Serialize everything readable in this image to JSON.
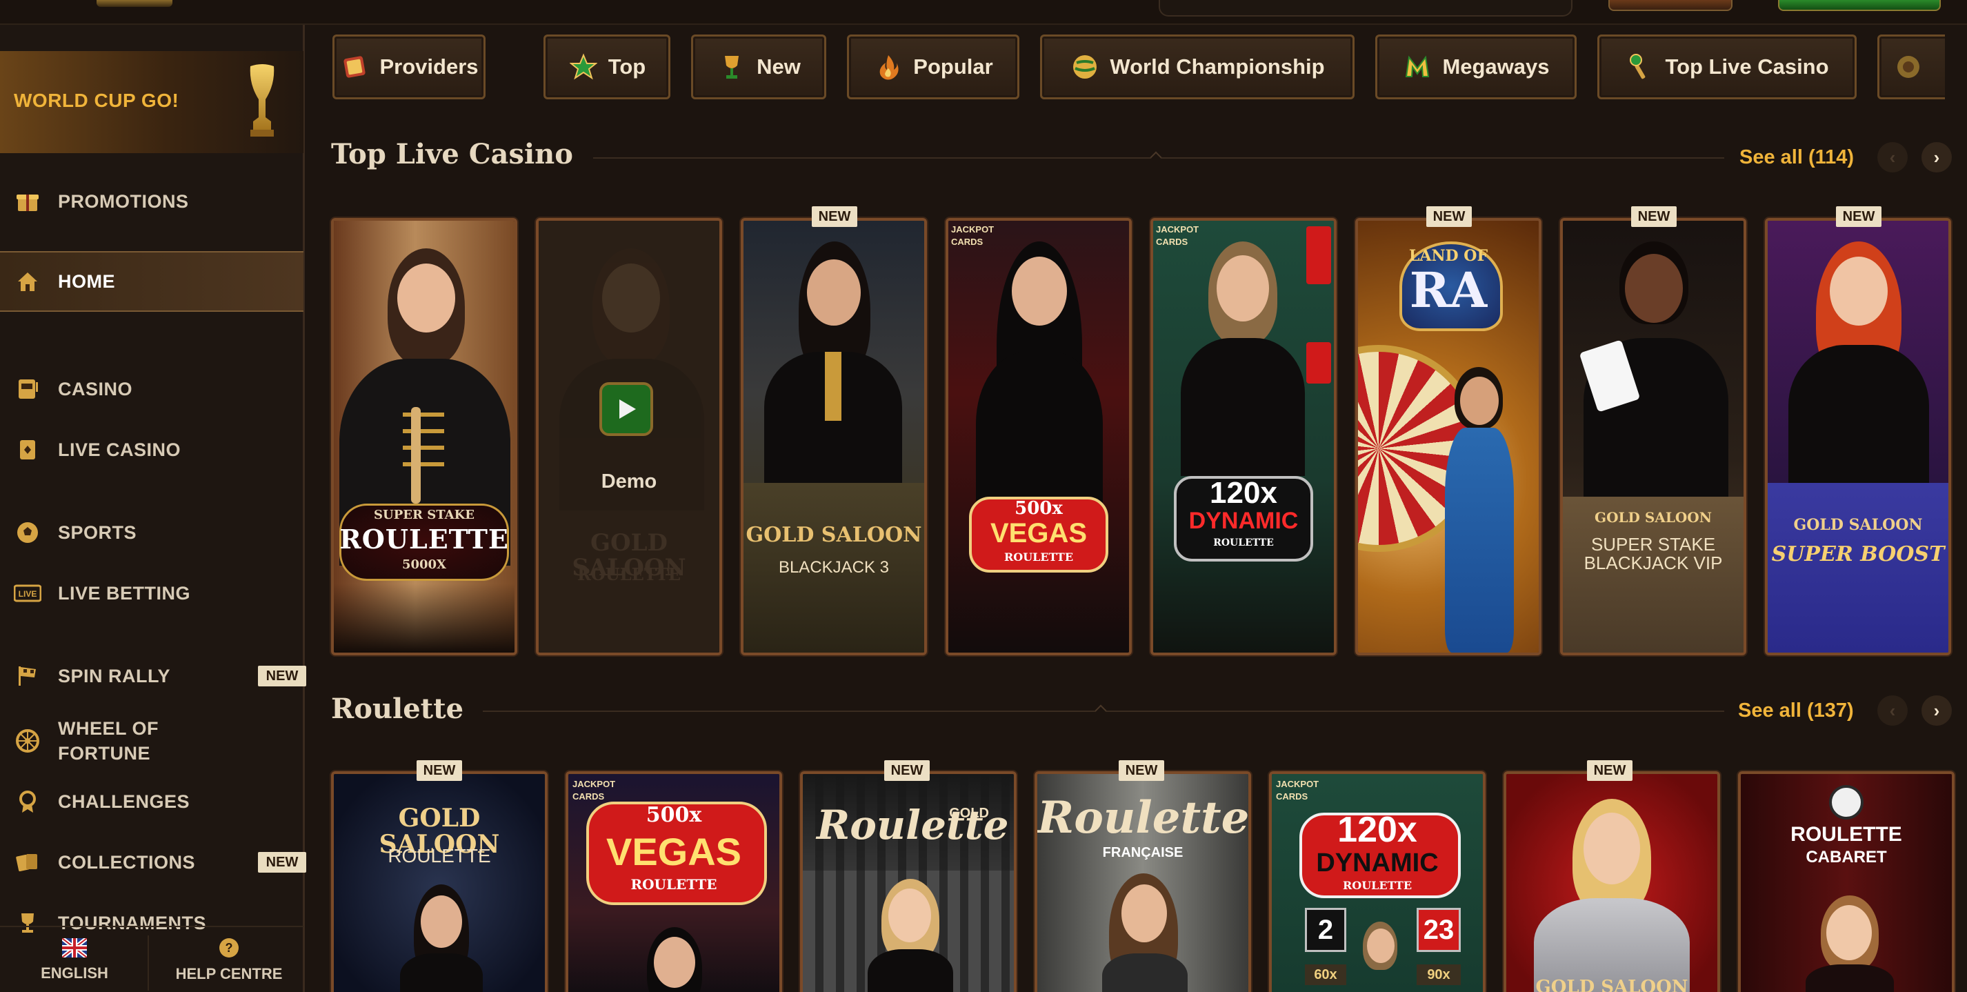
{
  "sidebar": {
    "banner": "WORLD CUP GO!",
    "items": [
      {
        "label": "PROMOTIONS"
      },
      {
        "label": "HOME"
      },
      {
        "label": "CASINO"
      },
      {
        "label": "LIVE CASINO"
      },
      {
        "label": "SPORTS"
      },
      {
        "label": "LIVE BETTING"
      },
      {
        "label": "SPIN RALLY",
        "badge": "NEW"
      },
      {
        "label": "WHEEL OF FORTUNE"
      },
      {
        "label": "CHALLENGES"
      },
      {
        "label": "COLLECTIONS",
        "badge": "NEW"
      },
      {
        "label": "TOURNAMENTS"
      }
    ],
    "footer": {
      "language": "ENGLISH",
      "help": "HELP CENTRE"
    }
  },
  "categories": [
    "Providers",
    "Top",
    "New",
    "Popular",
    "World Championship",
    "Megaways",
    "Top Live Casino"
  ],
  "sections": [
    {
      "title": "Top Live Casino",
      "see_all": "See all (114)",
      "cards": [
        {
          "t1": "SUPER STAKE",
          "t2": "ROULETTE",
          "t3": "5000X"
        },
        {
          "t1": "GOLD SALOON",
          "t2": "ROULETTE",
          "demo": "Demo"
        },
        {
          "badge": "NEW",
          "t1": "GOLD SALOON",
          "t2": "BLACKJACK 3"
        },
        {
          "tag": "JACKPOT CARDS",
          "t1": "500x",
          "t2": "VEGAS",
          "t3": "ROULETTE"
        },
        {
          "tag": "JACKPOT CARDS",
          "t1": "120x",
          "t2": "DYNAMIC",
          "t3": "ROULETTE"
        },
        {
          "badge": "NEW",
          "t1": "LAND OF",
          "t2": "RA"
        },
        {
          "badge": "NEW",
          "t1": "GOLD SALOON",
          "t2": "SUPER STAKE BLACKJACK VIP"
        },
        {
          "badge": "NEW",
          "t1": "GOLD SALOON",
          "t2": "SUPER BOOST"
        }
      ]
    },
    {
      "title": "Roulette",
      "see_all": "See all (137)",
      "cards": [
        {
          "badge": "NEW",
          "t1": "GOLD SALOON",
          "t2": "ROULETTE"
        },
        {
          "tag": "JACKPOT CARDS",
          "t1": "500x",
          "t2": "VEGAS",
          "t3": "ROULETTE"
        },
        {
          "badge": "NEW",
          "t1": "Roulette",
          "t2": "GOLD"
        },
        {
          "badge": "NEW",
          "t1": "Roulette",
          "t2": "FRANÇAISE"
        },
        {
          "tag": "JACKPOT CARDS",
          "t1": "120x",
          "t2": "DYNAMIC",
          "t3": "ROULETTE",
          "n1": "2",
          "n2": "23",
          "m1": "60x",
          "m2": "90x"
        },
        {
          "badge": "NEW",
          "t1": "GOLD SALOON"
        },
        {
          "t1": "ROULETTE",
          "t2": "CABARET"
        }
      ]
    }
  ],
  "colors": {
    "accent": "#f0b43a",
    "background": "#1c140f",
    "card_border": "#7a4a28"
  }
}
